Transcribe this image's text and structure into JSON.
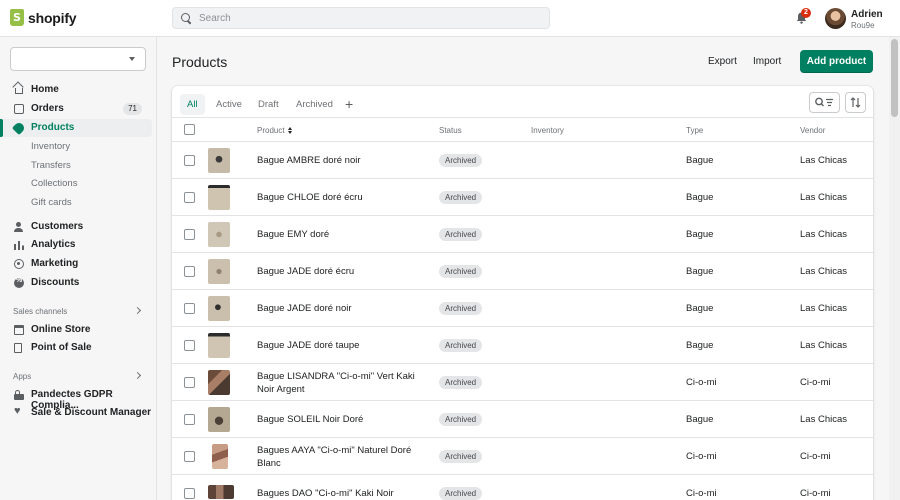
{
  "topbar": {
    "logo_text": "shopify",
    "search_placeholder": "Search",
    "notification_count": "2",
    "user_name": "Adrien",
    "user_store": "Rou9e"
  },
  "sidebar": {
    "items": [
      {
        "label": "Home",
        "icon": "home-icon"
      },
      {
        "label": "Orders",
        "icon": "orders-icon",
        "count": "71"
      },
      {
        "label": "Products",
        "icon": "tag-icon",
        "active": true
      },
      {
        "label": "Inventory",
        "sub": true
      },
      {
        "label": "Transfers",
        "sub": true
      },
      {
        "label": "Collections",
        "sub": true
      },
      {
        "label": "Gift cards",
        "sub": true
      },
      {
        "label": "Customers",
        "icon": "person-icon"
      },
      {
        "label": "Analytics",
        "icon": "bar-chart-icon"
      },
      {
        "label": "Marketing",
        "icon": "target-icon"
      },
      {
        "label": "Discounts",
        "icon": "discount-icon"
      }
    ],
    "sales_channels_label": "Sales channels",
    "channels": [
      {
        "label": "Online Store",
        "icon": "store-icon"
      },
      {
        "label": "Point of Sale",
        "icon": "pos-icon"
      }
    ],
    "apps_label": "Apps",
    "apps": [
      {
        "label": "Pandectes GDPR Complia...",
        "icon": "lock-icon"
      },
      {
        "label": "Sale & Discount Manager",
        "icon": "heart-icon"
      }
    ]
  },
  "header": {
    "title": "Products",
    "export_label": "Export",
    "import_label": "Import",
    "add_label": "Add product"
  },
  "tabs": [
    {
      "label": "All",
      "active": true
    },
    {
      "label": "Active"
    },
    {
      "label": "Draft"
    },
    {
      "label": "Archived"
    }
  ],
  "table": {
    "columns": {
      "product": "Product",
      "status": "Status",
      "inventory": "Inventory",
      "type": "Type",
      "vendor": "Vendor"
    },
    "rows": [
      {
        "name": "Bague AMBRE doré noir",
        "status": "Archived",
        "type": "Bague",
        "vendor": "Las Chicas"
      },
      {
        "name": "Bague CHLOE doré écru",
        "status": "Archived",
        "type": "Bague",
        "vendor": "Las Chicas"
      },
      {
        "name": "Bague EMY doré",
        "status": "Archived",
        "type": "Bague",
        "vendor": "Las Chicas"
      },
      {
        "name": "Bague JADE doré écru",
        "status": "Archived",
        "type": "Bague",
        "vendor": "Las Chicas"
      },
      {
        "name": "Bague JADE doré noir",
        "status": "Archived",
        "type": "Bague",
        "vendor": "Las Chicas"
      },
      {
        "name": "Bague JADE doré taupe",
        "status": "Archived",
        "type": "Bague",
        "vendor": "Las Chicas"
      },
      {
        "name": "Bague LISANDRA \"Ci-o-mi\" Vert Kaki Noir Argent",
        "status": "Archived",
        "type": "Ci-o-mi",
        "vendor": "Ci-o-mi"
      },
      {
        "name": "Bague SOLEIL Noir Doré",
        "status": "Archived",
        "type": "Bague",
        "vendor": "Las Chicas"
      },
      {
        "name": "Bagues AAYA \"Ci-o-mi\" Naturel Doré Blanc",
        "status": "Archived",
        "type": "Ci-o-mi",
        "vendor": "Ci-o-mi"
      },
      {
        "name": "Bagues DAO \"Ci-o-mi\" Kaki Noir",
        "status": "Archived",
        "type": "Ci-o-mi",
        "vendor": "Ci-o-mi"
      }
    ]
  },
  "colors": {
    "accent": "#008060",
    "badge_bg": "#e4e5e7",
    "notification": "#d82c0d"
  }
}
